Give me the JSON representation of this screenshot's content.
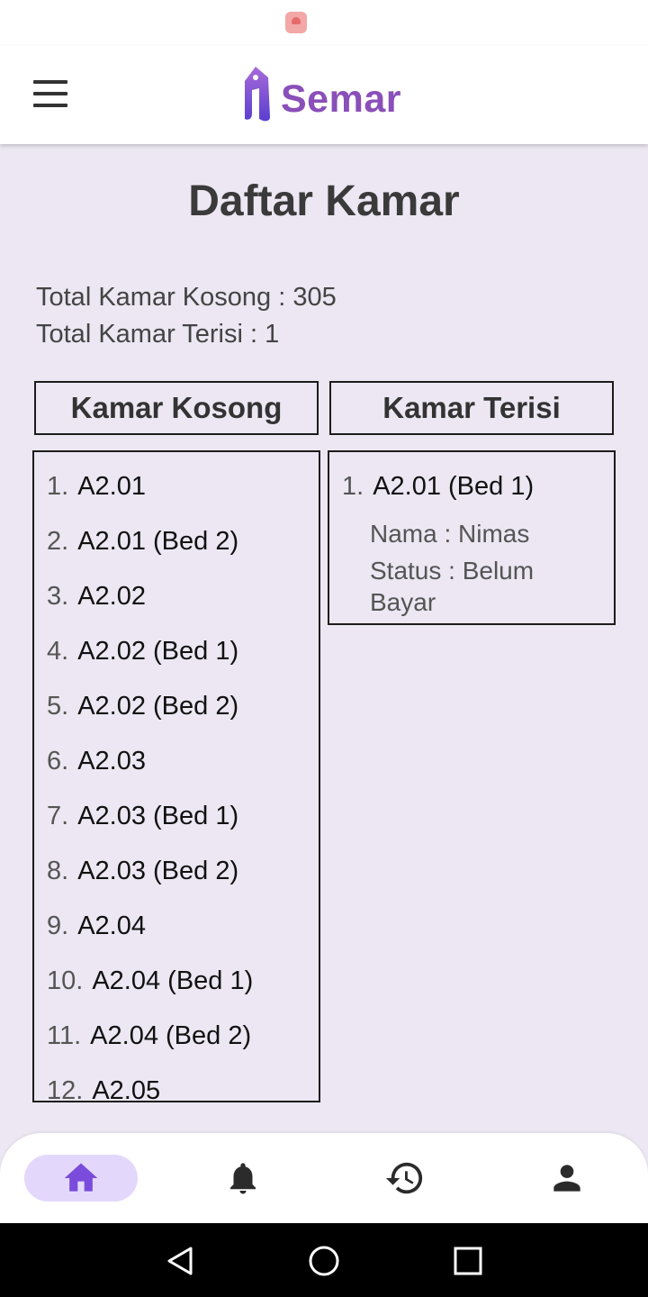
{
  "app": {
    "name": "Semar"
  },
  "page": {
    "title": "Daftar Kamar"
  },
  "totals": {
    "kosong": "Total Kamar Kosong : 305",
    "terisi": "Total Kamar Terisi : 1"
  },
  "columns": {
    "kosong": "Kamar Kosong",
    "terisi": "Kamar Terisi"
  },
  "kamar_kosong": [
    {
      "num": "1.",
      "room": "A2.01"
    },
    {
      "num": "2.",
      "room": "A2.01 (Bed 2)"
    },
    {
      "num": "3.",
      "room": "A2.02"
    },
    {
      "num": "4.",
      "room": "A2.02 (Bed 1)"
    },
    {
      "num": "5.",
      "room": "A2.02 (Bed 2)"
    },
    {
      "num": "6.",
      "room": "A2.03"
    },
    {
      "num": "7.",
      "room": "A2.03 (Bed 1)"
    },
    {
      "num": "8.",
      "room": "A2.03 (Bed 2)"
    },
    {
      "num": "9.",
      "room": "A2.04"
    },
    {
      "num": "10.",
      "room": "A2.04 (Bed 1)"
    },
    {
      "num": "11.",
      "room": "A2.04 (Bed 2)"
    },
    {
      "num": "12.",
      "room": "A2.05"
    }
  ],
  "kamar_terisi": [
    {
      "num": "1.",
      "room": "A2.01 (Bed 1)",
      "nama": "Nama : Nimas",
      "status": "Status : Belum Bayar"
    }
  ],
  "nav": {
    "items": [
      {
        "icon": "home-icon",
        "active": true
      },
      {
        "icon": "bell-icon",
        "active": false
      },
      {
        "icon": "history-icon",
        "active": false
      },
      {
        "icon": "person-icon",
        "active": false
      }
    ]
  },
  "colors": {
    "accent": "#7b4bdb",
    "active_pill": "#e3d8fb",
    "background": "#ece7f2"
  }
}
